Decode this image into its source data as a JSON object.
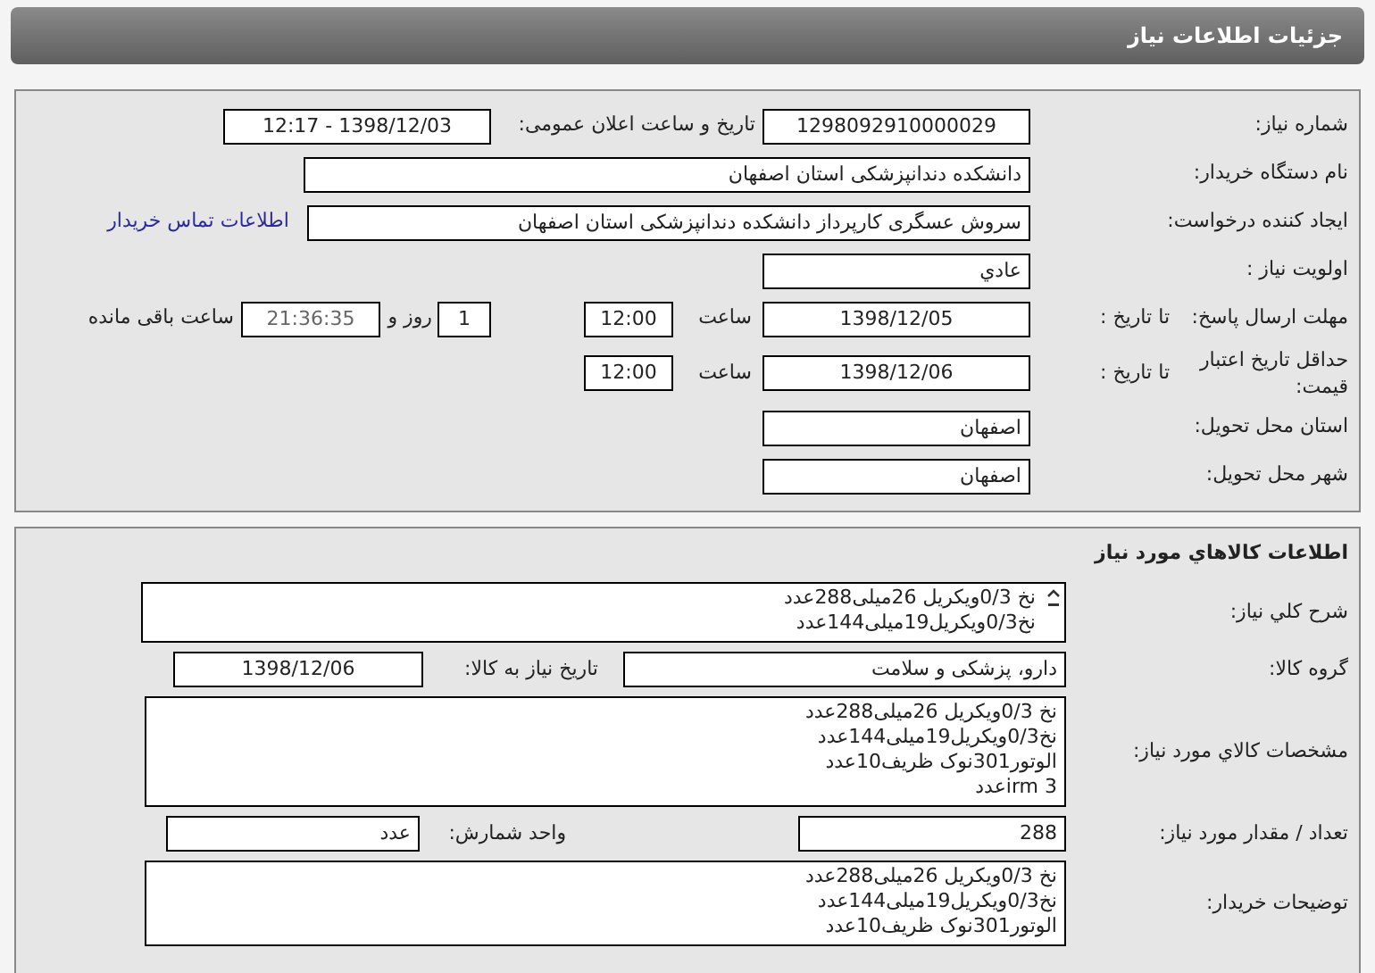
{
  "header": {
    "title": "جزئیات اطلاعات نیاز"
  },
  "general": {
    "need_number": {
      "label": "شماره نیاز:",
      "value": "1298092910000029"
    },
    "announce": {
      "label": "تاریخ و ساعت اعلان عمومی:",
      "value": "1398/12/03 - 12:17"
    },
    "buyer": {
      "label": "نام دستگاه خریدار:",
      "value": "دانشکده دندانپزشکی استان اصفهان"
    },
    "creator": {
      "label": "ایجاد کننده درخواست:",
      "value": "سروش عسگری کارپرداز دانشکده دندانپزشکی استان اصفهان",
      "link": "اطلاعات تماس خریدار"
    },
    "priority": {
      "label": "اولویت نیاز :",
      "value": "عادي"
    },
    "reply_deadline": {
      "label": "مهلت ارسال پاسخ:",
      "to_date_label": "تا تاریخ :",
      "date": "1398/12/05",
      "time_label": "ساعت",
      "time": "12:00",
      "days": "1",
      "days_label": "روز و",
      "remaining": "21:36:35",
      "remaining_label": "ساعت باقی مانده"
    },
    "price_validity": {
      "label": "حداقل تاریخ اعتبار قیمت:",
      "to_date_label": "تا تاریخ :",
      "date": "1398/12/06",
      "time_label": "ساعت",
      "time": "12:00"
    },
    "province": {
      "label": "استان محل تحویل:",
      "value": "اصفهان"
    },
    "city": {
      "label": "شهر محل تحویل:",
      "value": "اصفهان"
    }
  },
  "goods": {
    "title": "اطلاعات کالاهاي مورد نياز",
    "summary": {
      "label": "شرح کلي نياز:",
      "lines": [
        "نخ 0/3ویکریل 26میلی288عدد",
        "نخ0/3ویکریل19میلی144عدد"
      ]
    },
    "category": {
      "label": "گروه کالا:",
      "value": "دارو، پزشکی و سلامت"
    },
    "need_date": {
      "label": "تاریخ نیاز به کالا:",
      "value": "1398/12/06"
    },
    "specs": {
      "label": "مشخصات کالاي مورد نياز:",
      "lines": [
        "نخ 0/3ویکریل 26میلی288عدد",
        "نخ0/3ویکریل19میلی144عدد",
        "الوتور301نوک ظریف10عدد",
        "3  irmعدد"
      ]
    },
    "quantity": {
      "label": "تعداد / مقدار مورد نياز:",
      "value": "288"
    },
    "unit": {
      "label": "واحد شمارش:",
      "value": "عدد"
    },
    "buyer_notes": {
      "label": "توضیحات خریدار:",
      "lines": [
        "نخ 0/3ویکریل 26میلی288عدد",
        "نخ0/3ویکریل19میلی144عدد",
        "الوتور301نوک ظریف10عدد"
      ]
    }
  }
}
